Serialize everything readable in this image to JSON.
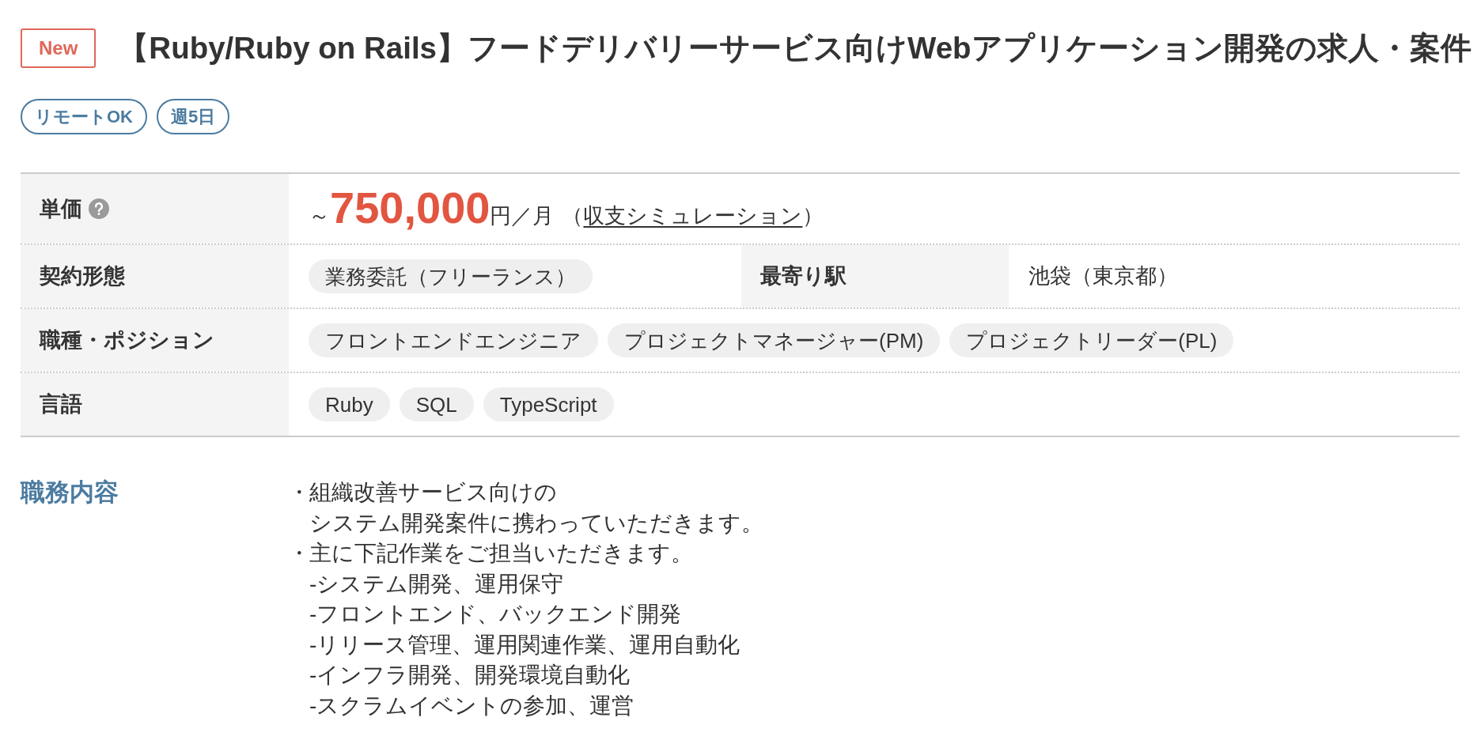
{
  "header": {
    "badge": "New",
    "title": "【Ruby/Ruby on Rails】フードデリバリーサービス向けWebアプリケーション開発の求人・案件"
  },
  "tags": [
    "リモートOK",
    "週5日"
  ],
  "details": {
    "rows": [
      {
        "cells": [
          {
            "kind": "price",
            "label": "単価",
            "prefix": "～",
            "amount": "750,000",
            "unit": "円／月",
            "note_open": "（",
            "link": "収支シミュレーション",
            "note_close": "）"
          }
        ]
      },
      {
        "cells": [
          {
            "kind": "chips",
            "label": "契約形態",
            "chips": [
              "業務委託（フリーランス）"
            ]
          },
          {
            "kind": "text",
            "label": "最寄り駅",
            "text": "池袋（東京都）"
          }
        ]
      },
      {
        "cells": [
          {
            "kind": "chips",
            "label": "職種・ポジション",
            "chips": [
              "フロントエンドエンジニア",
              "プロジェクトマネージャー(PM)",
              "プロジェクトリーダー(PL)"
            ]
          }
        ]
      },
      {
        "cells": [
          {
            "kind": "chips",
            "label": "言語",
            "chips": [
              "Ruby",
              "SQL",
              "TypeScript"
            ]
          }
        ]
      }
    ]
  },
  "job_description": {
    "heading": "職務内容",
    "items": [
      {
        "marker": "・",
        "lines": [
          "組織改善サービス向けの",
          "システム開発案件に携わっていただきます。"
        ]
      },
      {
        "marker": "・",
        "lines": [
          "主に下記作業をご担当いただきます。"
        ],
        "children": [
          {
            "text": "-システム開発、運用保守"
          },
          {
            "text": "-フロントエンド、バックエンド開発"
          },
          {
            "text": "-リリース管理、運用関連作業、運用自動化"
          },
          {
            "text": "-インフラ開発、開発環境自動化"
          },
          {
            "text": "-スクラムイベントの参加、運営"
          }
        ]
      }
    ]
  }
}
